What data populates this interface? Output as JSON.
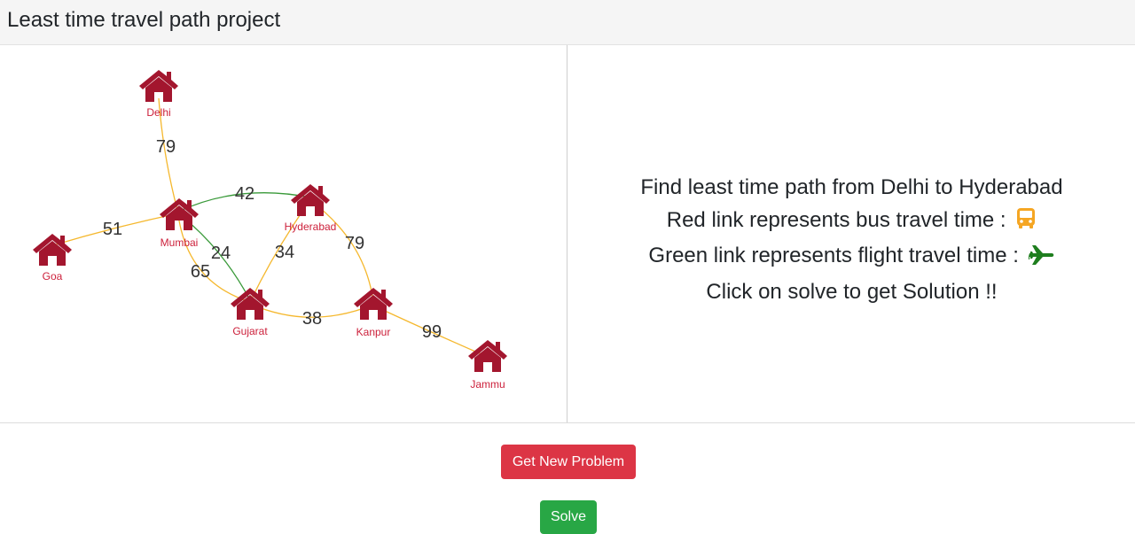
{
  "header": {
    "title": "Least time travel path project"
  },
  "graph": {
    "nodes": [
      {
        "id": "delhi",
        "label": "Delhi"
      },
      {
        "id": "mumbai",
        "label": "Mumbai"
      },
      {
        "id": "goa",
        "label": "Goa"
      },
      {
        "id": "hyderabad",
        "label": "Hyderabad"
      },
      {
        "id": "gujarat",
        "label": "Gujarat"
      },
      {
        "id": "kanpur",
        "label": "Kanpur"
      },
      {
        "id": "jammu",
        "label": "Jammu"
      }
    ],
    "edges": [
      {
        "from": "Delhi",
        "to": "Mumbai",
        "weight": "79",
        "mode": "bus"
      },
      {
        "from": "Goa",
        "to": "Mumbai",
        "weight": "51",
        "mode": "bus"
      },
      {
        "from": "Mumbai",
        "to": "Hyderabad",
        "weight": "42",
        "mode": "flight"
      },
      {
        "from": "Mumbai",
        "to": "Gujarat",
        "weight": "24",
        "mode": "flight"
      },
      {
        "from": "Mumbai",
        "to": "Gujarat",
        "weight": "65",
        "mode": "bus"
      },
      {
        "from": "Hyderabad",
        "to": "Gujarat",
        "weight": "34",
        "mode": "bus"
      },
      {
        "from": "Hyderabad",
        "to": "Kanpur",
        "weight": "79",
        "mode": "bus"
      },
      {
        "from": "Gujarat",
        "to": "Kanpur",
        "weight": "38",
        "mode": "bus"
      },
      {
        "from": "Kanpur",
        "to": "Jammu",
        "weight": "99",
        "mode": "bus"
      }
    ],
    "colors": {
      "node": "#a3162e",
      "bus_edge": "#f5b82e",
      "flight_edge": "#3a9a3a"
    }
  },
  "info": {
    "line1": "Find least time path from Delhi to Hyderabad",
    "line2": "Red link represents bus travel time :",
    "line2_icon": "bus-icon",
    "line3": "Green link represents flight travel time :",
    "line3_icon": "airplane-icon",
    "line4": "Click on solve to get Solution !!"
  },
  "buttons": {
    "new_problem": "Get New Problem",
    "solve": "Solve"
  },
  "colors": {
    "red_button": "#dc3545",
    "green_button": "#28a745",
    "bus_icon": "#f5a623",
    "airplane_icon": "#1e7e1e"
  }
}
